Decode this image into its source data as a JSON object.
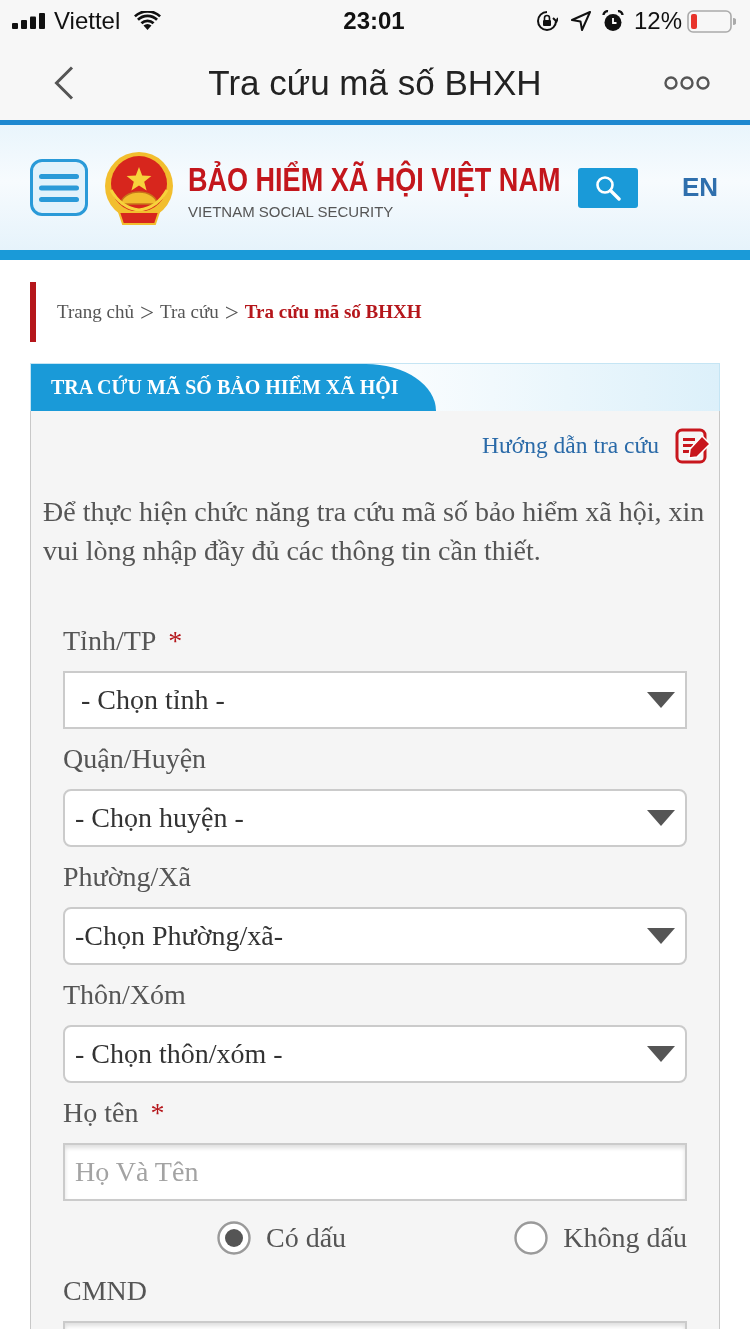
{
  "status_bar": {
    "carrier": "Viettel",
    "time": "23:01",
    "battery": "12%"
  },
  "nav_bar": {
    "title": "Tra cứu mã số BHXH"
  },
  "site_header": {
    "title": "BẢO HIỂM XÃ HỘI VIỆT NAM",
    "subtitle": "VIETNAM SOCIAL SECURITY",
    "language": "EN"
  },
  "breadcrumb": {
    "items": [
      {
        "label": "Trang chủ",
        "selected": false
      },
      {
        "label": "Tra cứu",
        "selected": false
      },
      {
        "label": "Tra cứu mã số BHXH",
        "selected": true
      }
    ],
    "separators": [
      ">",
      ">"
    ]
  },
  "panel": {
    "title": "TRA CỨU MÃ SỐ BẢO HIỂM XÃ HỘI",
    "help_link": "Hướng dẫn tra cứu",
    "intro": "Để thực hiện chức năng tra cứu mã số bảo hiểm xã hội, xin vui lòng nhập đầy đủ các thông tin cần thiết.",
    "fields": [
      {
        "kind": "select",
        "label": "Tỉnh/TP",
        "required_mark": "*",
        "value": "- Chọn tỉnh -"
      },
      {
        "kind": "select",
        "label": "Quận/Huyện",
        "value": "- Chọn huyện -"
      },
      {
        "kind": "select",
        "label": "Phường/Xã",
        "value": "-Chọn Phường/xã-"
      },
      {
        "kind": "select",
        "label": "Thôn/Xóm",
        "value": "- Chọn thôn/xóm -"
      },
      {
        "kind": "text",
        "label": "Họ tên",
        "required_mark": "*",
        "placeholder": "Họ Và Tên"
      },
      {
        "kind": "radio",
        "options": [
          {
            "label": "Có dấu",
            "selected": true
          },
          {
            "label": "Không dấu",
            "selected": false
          }
        ]
      },
      {
        "kind": "text",
        "label": "CMND"
      }
    ]
  }
}
